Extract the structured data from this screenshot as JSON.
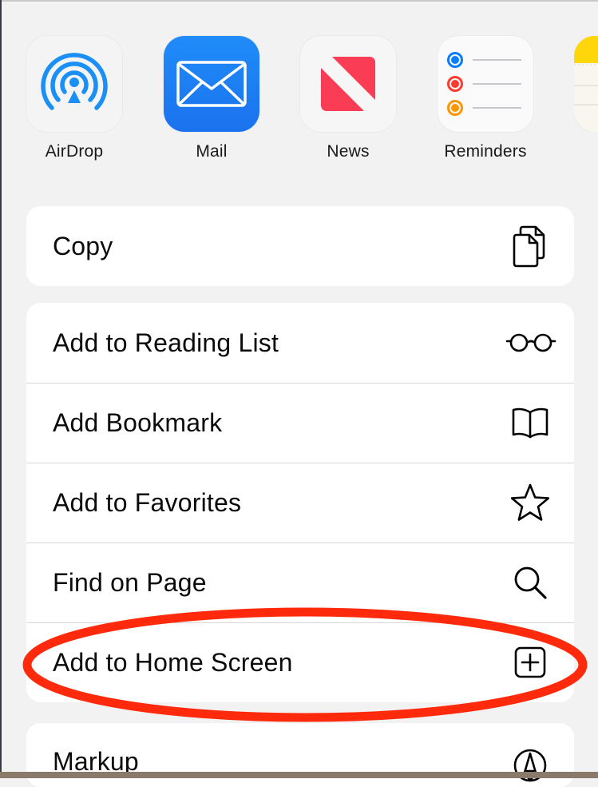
{
  "apps": [
    {
      "label": "AirDrop",
      "icon": "airdrop-icon"
    },
    {
      "label": "Mail",
      "icon": "mail-icon"
    },
    {
      "label": "News",
      "icon": "news-icon"
    },
    {
      "label": "Reminders",
      "icon": "reminders-icon"
    }
  ],
  "actions": {
    "copy": {
      "label": "Copy",
      "icon": "copy-icon"
    },
    "reading_list": {
      "label": "Add to Reading List",
      "icon": "glasses-icon"
    },
    "bookmark": {
      "label": "Add Bookmark",
      "icon": "book-icon"
    },
    "favorites": {
      "label": "Add to Favorites",
      "icon": "star-icon"
    },
    "find": {
      "label": "Find on Page",
      "icon": "search-icon"
    },
    "home_screen": {
      "label": "Add to Home Screen",
      "icon": "plus-square-icon"
    },
    "markup": {
      "label": "Markup",
      "icon": "markup-pen-icon"
    }
  },
  "colors": {
    "annotation": "#ff2a0c",
    "airdrop": "#1a8ff5",
    "mail": "#1b7ef2",
    "news": "#fa3c55",
    "reminder_blue": "#0a7cff",
    "reminder_red": "#ff3b30",
    "reminder_orange": "#ff9500"
  }
}
